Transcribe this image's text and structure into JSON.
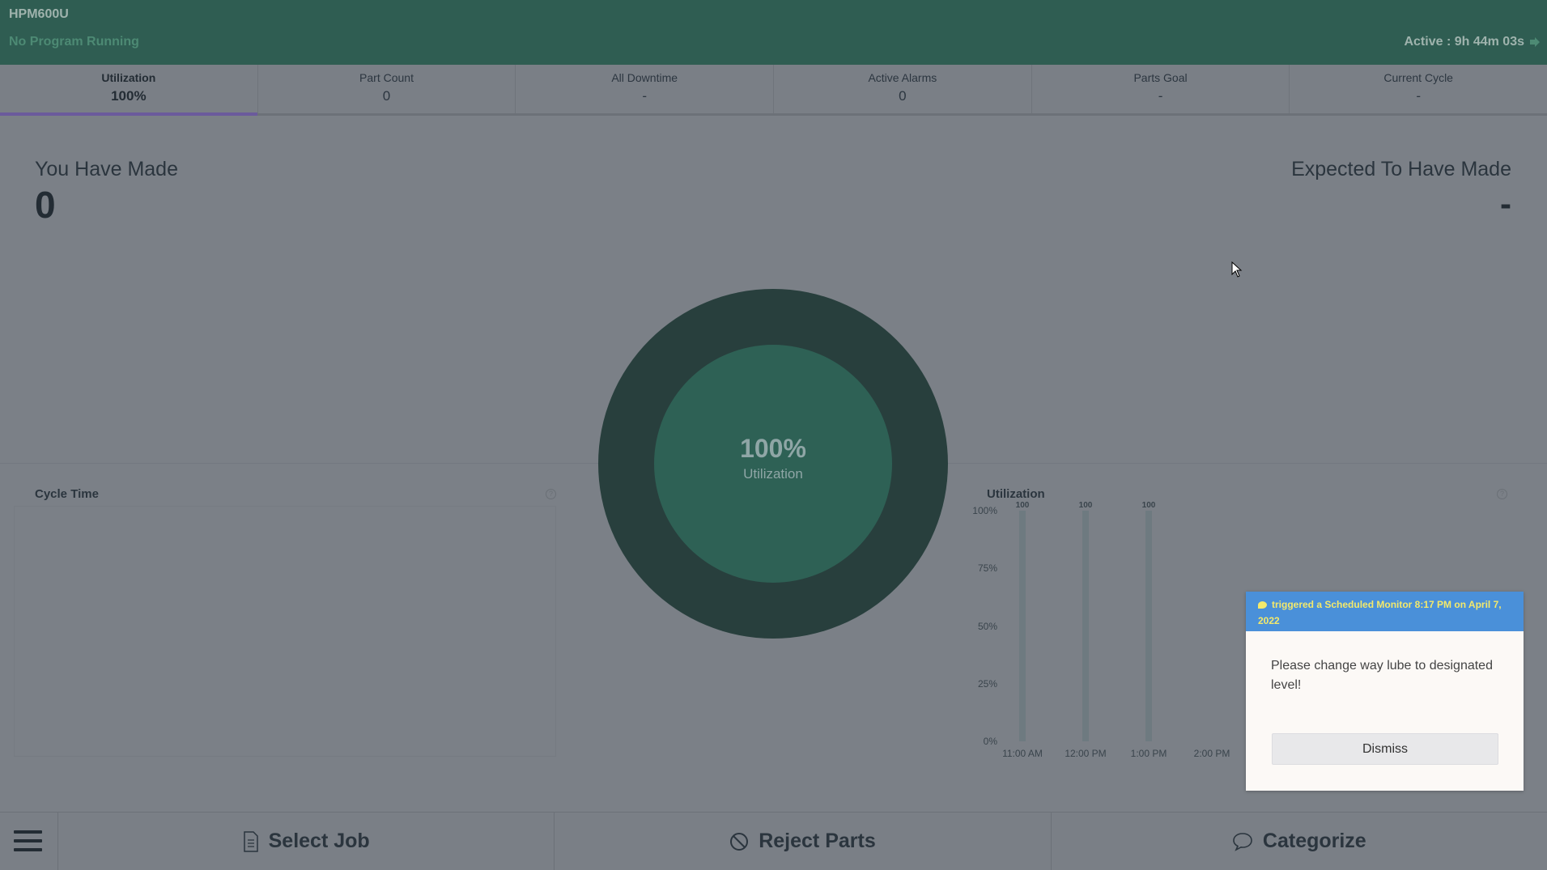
{
  "header": {
    "machine_name": "HPM600U",
    "program_status": "No Program Running",
    "active_time": "Active : 9h 44m 03s",
    "active_icon": "running-icon"
  },
  "tabs": [
    {
      "label": "Utilization",
      "value": "100%",
      "active": true
    },
    {
      "label": "Part Count",
      "value": "0"
    },
    {
      "label": "All Downtime",
      "value": "-"
    },
    {
      "label": "Active Alarms",
      "value": "0"
    },
    {
      "label": "Parts Goal",
      "value": "-"
    },
    {
      "label": "Current Cycle",
      "value": "-"
    }
  ],
  "stats": {
    "made_label": "You Have Made",
    "made_value": "0",
    "expected_label": "Expected To Have Made",
    "expected_value": "-"
  },
  "donut": {
    "value": "100%",
    "label": "Utilization",
    "fraction": 1.0
  },
  "cycle_panel": {
    "title": "Cycle Time",
    "help_icon": "help-circle-icon"
  },
  "util_panel": {
    "title": "Utilization",
    "help_icon": "help-circle-icon"
  },
  "chart_data": {
    "type": "bar",
    "title": "Utilization",
    "categories": [
      "11:00 AM",
      "12:00 PM",
      "1:00 PM",
      "2:00 PM"
    ],
    "values": [
      100,
      100,
      100,
      null
    ],
    "data_labels": [
      "100",
      "100",
      "100",
      ""
    ],
    "y_ticks": [
      "100%",
      "75%",
      "50%",
      "25%",
      "0%"
    ],
    "ylim": [
      0,
      100
    ]
  },
  "toast": {
    "header": "triggered a Scheduled Monitor 8:17 PM on April 7, 2022",
    "message": "Please change way lube to designated level!",
    "dismiss_label": "Dismiss",
    "colors": {
      "header_bg": "#4a90d9",
      "header_text": "#f4e96b"
    }
  },
  "bottom_bar": {
    "menu_icon": "hamburger-menu-icon",
    "select_job": "Select Job",
    "reject_parts": "Reject Parts",
    "categorize": "Categorize"
  },
  "colors": {
    "header_bg": "#2f5d52",
    "tab_active_underline": "#6b5a9c",
    "donut_outer": "#283f3d",
    "donut_inner": "#2e6155"
  }
}
